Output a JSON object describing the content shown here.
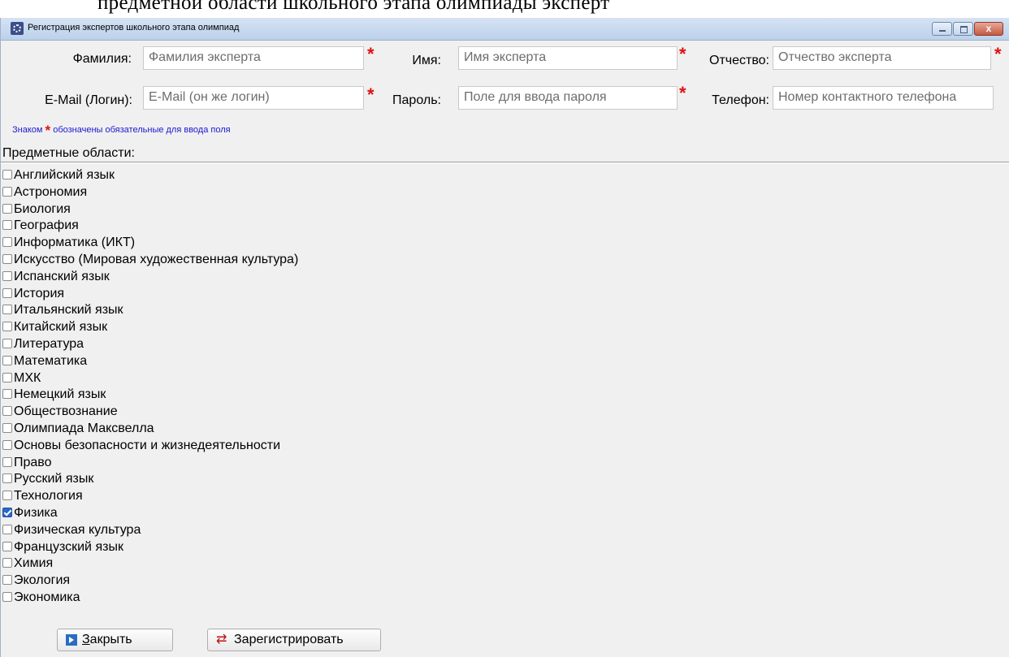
{
  "document_text": "предметной области школьного этапа олимпиады эксперт",
  "window": {
    "title": "Регистрация экспертов школьного этапа олимпиад",
    "close_glyph": "x"
  },
  "form": {
    "surname_label": "Фамилия:",
    "surname_placeholder": "Фамилия эксперта",
    "name_label": "Имя:",
    "name_placeholder": "Имя эксперта",
    "patronymic_label": "Отчество:",
    "patronymic_placeholder": "Отчество эксперта",
    "email_label": "E-Mail (Логин):",
    "email_placeholder": "E-Mail (он же логин)",
    "password_label": "Пароль:",
    "password_placeholder": "Поле для ввода пароля",
    "phone_label": "Телефон:",
    "phone_placeholder": "Номер контактного телефона",
    "required_mark": "*",
    "note_prefix": "Знаком",
    "note_suffix": "обозначены обязательные для ввода поля"
  },
  "subjects": {
    "title": "Предметные области:",
    "items": [
      {
        "label": "Английский язык",
        "checked": false
      },
      {
        "label": "Астрономия",
        "checked": false
      },
      {
        "label": "Биология",
        "checked": false
      },
      {
        "label": "География",
        "checked": false
      },
      {
        "label": "Информатика (ИКТ)",
        "checked": false
      },
      {
        "label": "Искусство (Мировая художественная культура)",
        "checked": false
      },
      {
        "label": "Испанский язык",
        "checked": false
      },
      {
        "label": "История",
        "checked": false
      },
      {
        "label": "Итальянский язык",
        "checked": false
      },
      {
        "label": "Китайский язык",
        "checked": false
      },
      {
        "label": "Литература",
        "checked": false
      },
      {
        "label": "Математика",
        "checked": false
      },
      {
        "label": "МХК",
        "checked": false
      },
      {
        "label": "Немецкий язык",
        "checked": false
      },
      {
        "label": "Обществознание",
        "checked": false
      },
      {
        "label": "Олимпиада Максвелла",
        "checked": false
      },
      {
        "label": "Основы безопасности и жизнедеятельности",
        "checked": false
      },
      {
        "label": "Право",
        "checked": false
      },
      {
        "label": "Русский язык",
        "checked": false
      },
      {
        "label": "Технология",
        "checked": false
      },
      {
        "label": "Физика",
        "checked": true
      },
      {
        "label": "Физическая культура",
        "checked": false
      },
      {
        "label": "Французский язык",
        "checked": false
      },
      {
        "label": "Химия",
        "checked": false
      },
      {
        "label": "Экология",
        "checked": false
      },
      {
        "label": "Экономика",
        "checked": false
      }
    ]
  },
  "buttons": {
    "close_label": "Закрыть",
    "register_label": "Зарегистрировать"
  },
  "colors": {
    "required": "#e01010",
    "note_text": "#1a1ad0",
    "checkbox_checked": "#2c68c8"
  }
}
